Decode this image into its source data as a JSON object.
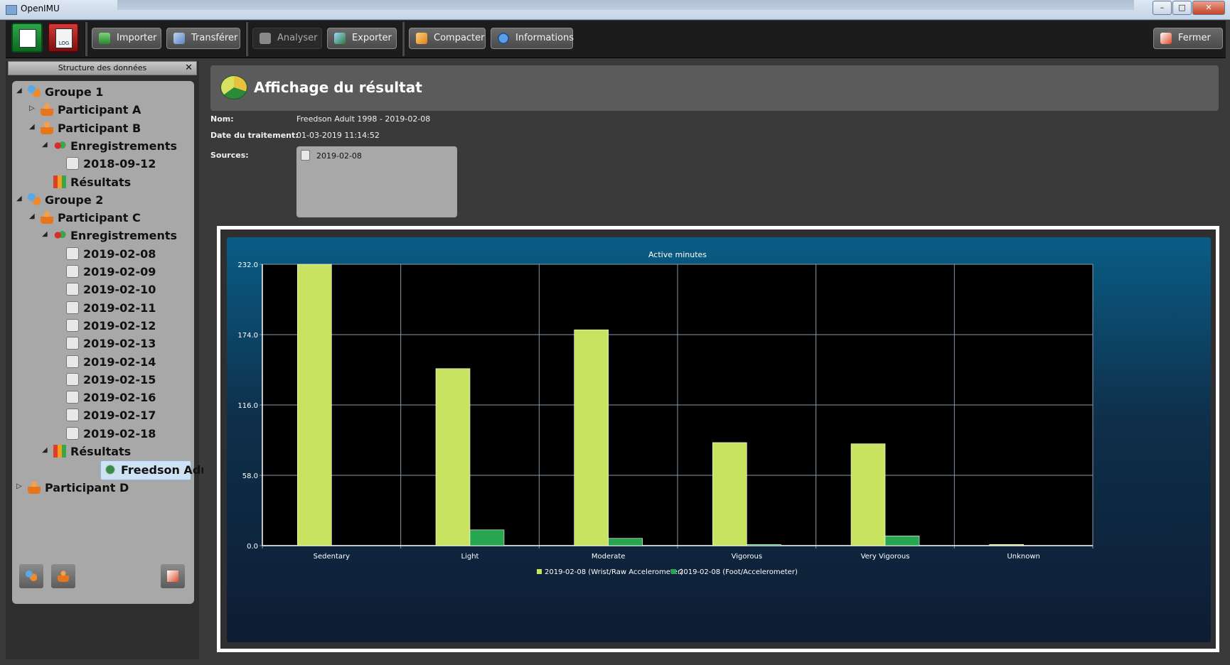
{
  "window": {
    "title": "OpenIMU",
    "minimize_label": "–",
    "maximize_label": "□",
    "close_label": "✕"
  },
  "toolbar": {
    "import_label": "Importer",
    "transfer_label": "Transférer",
    "analyze_label": "Analyser",
    "export_label": "Exporter",
    "compact_label": "Compacter",
    "info_label": "Informations",
    "close_label": "Fermer",
    "log_label": "LOG"
  },
  "sidebar": {
    "title": "Structure des données",
    "close_label": "✕",
    "tree": [
      {
        "label": "Groupe 1",
        "icon": "group-icon",
        "level": 0,
        "arrow": "◢"
      },
      {
        "label": "Participant A",
        "icon": "person-icon",
        "level": 1,
        "arrow": "▷"
      },
      {
        "label": "Participant B",
        "icon": "person-icon",
        "level": 1,
        "arrow": "◢"
      },
      {
        "label": "Enregistrements",
        "icon": "recordings-icon",
        "level": 2,
        "arrow": "◢"
      },
      {
        "label": "2018-09-12",
        "icon": "recording-icon",
        "level": 3,
        "arrow": ""
      },
      {
        "label": "Résultats",
        "icon": "results-icon",
        "level": 2,
        "arrow": ""
      },
      {
        "label": "Groupe 2",
        "icon": "group-icon",
        "level": 0,
        "arrow": "◢"
      },
      {
        "label": "Participant C",
        "icon": "person-icon",
        "level": 1,
        "arrow": "◢"
      },
      {
        "label": "Enregistrements",
        "icon": "recordings-icon",
        "level": 2,
        "arrow": "◢"
      },
      {
        "label": "2019-02-08",
        "icon": "recording-icon",
        "level": 3,
        "arrow": ""
      },
      {
        "label": "2019-02-09",
        "icon": "recording-icon",
        "level": 3,
        "arrow": ""
      },
      {
        "label": "2019-02-10",
        "icon": "recording-icon",
        "level": 3,
        "arrow": ""
      },
      {
        "label": "2019-02-11",
        "icon": "recording-icon",
        "level": 3,
        "arrow": ""
      },
      {
        "label": "2019-02-12",
        "icon": "recording-icon",
        "level": 3,
        "arrow": ""
      },
      {
        "label": "2019-02-13",
        "icon": "recording-icon",
        "level": 3,
        "arrow": ""
      },
      {
        "label": "2019-02-14",
        "icon": "recording-icon",
        "level": 3,
        "arrow": ""
      },
      {
        "label": "2019-02-15",
        "icon": "recording-icon",
        "level": 3,
        "arrow": ""
      },
      {
        "label": "2019-02-16",
        "icon": "recording-icon",
        "level": 3,
        "arrow": ""
      },
      {
        "label": "2019-02-17",
        "icon": "recording-icon",
        "level": 3,
        "arrow": ""
      },
      {
        "label": "2019-02-18",
        "icon": "recording-icon",
        "level": 3,
        "arrow": ""
      },
      {
        "label": "Résultats",
        "icon": "results-icon",
        "level": 2,
        "arrow": "◢"
      },
      {
        "label": "Freedson Adult ...",
        "icon": "result-icon",
        "level": 3,
        "arrow": "",
        "selected": true
      },
      {
        "label": "Participant D",
        "icon": "person-icon",
        "level": 0,
        "arrow": "▷"
      }
    ]
  },
  "result": {
    "header": "Affichage du résultat",
    "name_label": "Nom:",
    "name_value": "Freedson Adult 1998 - 2019-02-08",
    "date_label": "Date du traitement:",
    "date_value": "01-03-2019 11:14:52",
    "sources_label": "Sources:",
    "sources": [
      "2019-02-08"
    ]
  },
  "colors": {
    "series1": "#c8e35f",
    "series2": "#27a64f",
    "plot_bg": "#000000",
    "grid": "#8a98aa"
  },
  "chart_data": {
    "type": "bar",
    "title": "Active minutes",
    "categories": [
      "Sedentary",
      "Light",
      "Moderate",
      "Vigorous",
      "Very Vigorous",
      "Unknown"
    ],
    "series": [
      {
        "name": "2019-02-08 (Wrist/Raw Accelerometer)",
        "values": [
          232,
          146,
          178,
          85,
          84,
          1
        ]
      },
      {
        "name": "2019-02-08 (Foot/Accelerometer)",
        "values": [
          0,
          13,
          6,
          1,
          8,
          0
        ]
      }
    ],
    "ylim": [
      0,
      232
    ],
    "yticks": [
      "0.0",
      "58.0",
      "116.0",
      "174.0",
      "232.0"
    ],
    "grid": true,
    "legend_position": "bottom"
  }
}
